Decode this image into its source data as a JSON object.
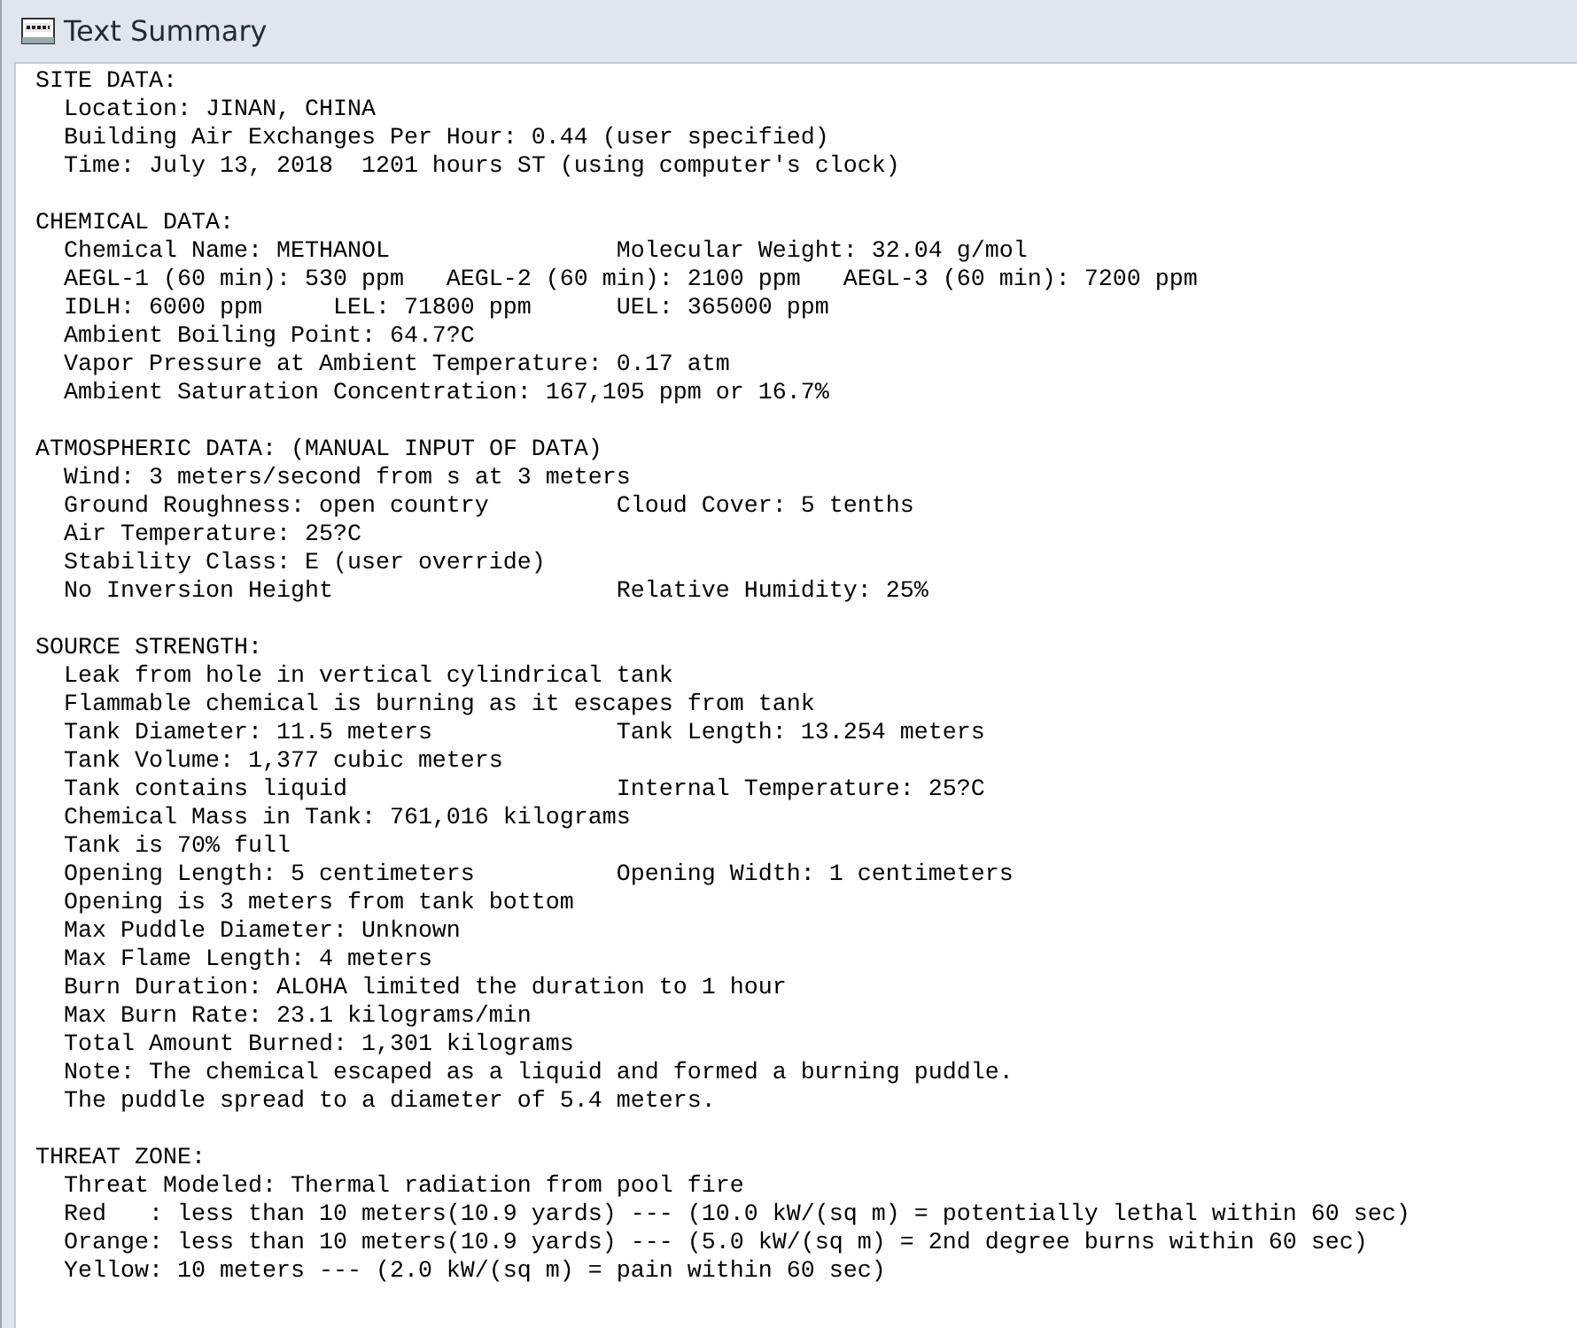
{
  "window": {
    "title": "Text Summary"
  },
  "sections": [
    {
      "heading": "SITE DATA:",
      "lines": [
        {
          "text": "Location: JINAN, CHINA"
        },
        {
          "text": "Building Air Exchanges Per Hour: 0.44 (user specified)"
        },
        {
          "text": "Time: July 13, 2018  1201 hours ST (using computer's clock)"
        }
      ]
    },
    {
      "heading": "CHEMICAL DATA:",
      "lines": [
        {
          "text": "Chemical Name: METHANOL",
          "right": "Molecular Weight: 32.04 g/mol"
        },
        {
          "text": "AEGL-1 (60 min): 530 ppm   AEGL-2 (60 min): 2100 ppm   AEGL-3 (60 min): 7200 ppm"
        },
        {
          "text": "IDLH: 6000 ppm     LEL: 71800 ppm",
          "right": "UEL: 365000 ppm"
        },
        {
          "text": "Ambient Boiling Point: 64.7?C"
        },
        {
          "text": "Vapor Pressure at Ambient Temperature: 0.17 atm"
        },
        {
          "text": "Ambient Saturation Concentration: 167,105 ppm or 16.7%"
        }
      ]
    },
    {
      "heading": "ATMOSPHERIC DATA: (MANUAL INPUT OF DATA)",
      "lines": [
        {
          "text": "Wind: 3 meters/second from s at 3 meters"
        },
        {
          "text": "Ground Roughness: open country",
          "right": "Cloud Cover: 5 tenths"
        },
        {
          "text": "Air Temperature: 25?C"
        },
        {
          "text": "Stability Class: E (user override)"
        },
        {
          "text": "No Inversion Height",
          "right": "Relative Humidity: 25%"
        }
      ]
    },
    {
      "heading": "SOURCE STRENGTH:",
      "lines": [
        {
          "text": "Leak from hole in vertical cylindrical tank"
        },
        {
          "text": "Flammable chemical is burning as it escapes from tank"
        },
        {
          "text": "Tank Diameter: 11.5 meters",
          "right": "Tank Length: 13.254 meters"
        },
        {
          "text": "Tank Volume: 1,377 cubic meters"
        },
        {
          "text": "Tank contains liquid",
          "right": "Internal Temperature: 25?C"
        },
        {
          "text": "Chemical Mass in Tank: 761,016 kilograms"
        },
        {
          "text": "Tank is 70% full"
        },
        {
          "text": "Opening Length: 5 centimeters",
          "right": "Opening Width: 1 centimeters"
        },
        {
          "text": "Opening is 3 meters from tank bottom"
        },
        {
          "text": "Max Puddle Diameter: Unknown"
        },
        {
          "text": "Max Flame Length: 4 meters"
        },
        {
          "text": "Burn Duration: ALOHA limited the duration to 1 hour"
        },
        {
          "text": "Max Burn Rate: 23.1 kilograms/min"
        },
        {
          "text": "Total Amount Burned: 1,301 kilograms"
        },
        {
          "text": "Note: The chemical escaped as a liquid and formed a burning puddle."
        },
        {
          "text": "The puddle spread to a diameter of 5.4 meters."
        }
      ]
    },
    {
      "heading": "THREAT ZONE:",
      "lines": [
        {
          "text": "Threat Modeled: Thermal radiation from pool fire"
        },
        {
          "text": "Red   : less than 10 meters(10.9 yards) --- (10.0 kW/(sq m) = potentially lethal within 60 sec)"
        },
        {
          "text": "Orange: less than 10 meters(10.9 yards) --- (5.0 kW/(sq m) = 2nd degree burns within 60 sec)"
        },
        {
          "text": "Yellow: 10 meters --- (2.0 kW/(sq m) = pain within 60 sec)"
        }
      ]
    }
  ]
}
